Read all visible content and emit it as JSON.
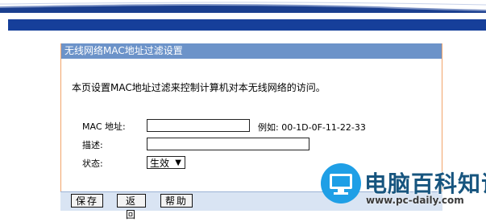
{
  "panel": {
    "title": "无线网络MAC地址过滤设置",
    "description": "本页设置MAC地址过滤来控制计算机对本无线网络的访问。"
  },
  "form": {
    "mac_label": "MAC 地址:",
    "mac_value": "",
    "mac_example": "例如: 00-1D-0F-11-22-33",
    "desc_label": "描述:",
    "desc_value": "",
    "status_label": "状态:",
    "status_selected": "生效"
  },
  "buttons": {
    "save": "保存",
    "back": "返回",
    "help": "帮助"
  },
  "watermark": {
    "title": "电脑百科知识",
    "url": "www.pc-daily.com"
  },
  "colors": {
    "title_bar": "#6c93c9",
    "banner_bar": "#163f9a",
    "panel_border": "#f2a46a",
    "watermark_icon": "#1f9fe6"
  }
}
